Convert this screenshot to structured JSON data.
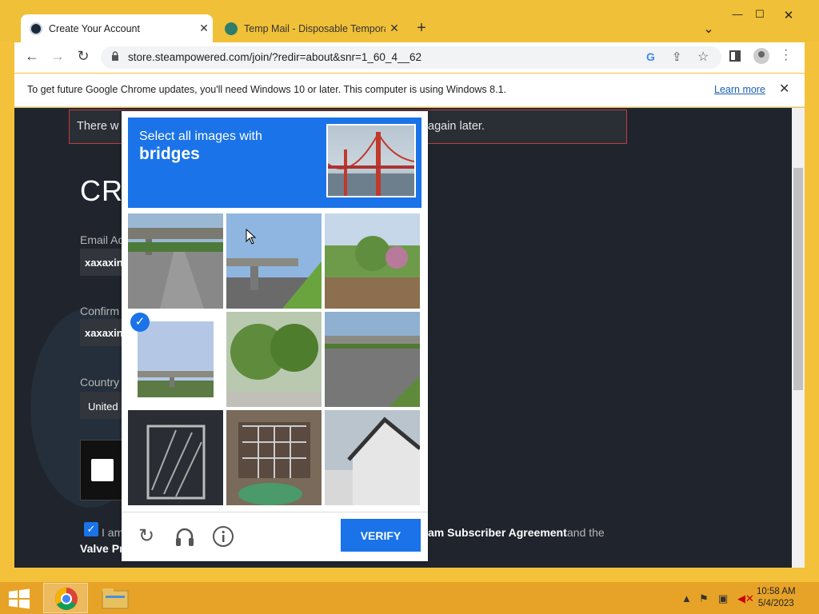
{
  "browser": {
    "tabs": [
      {
        "title": "Create Your Account",
        "active": true
      },
      {
        "title": "Temp Mail - Disposable Tempora",
        "active": false
      }
    ],
    "new_tab_label": "+",
    "window_controls": {
      "dropdown": "⌄",
      "minimize": "—",
      "maximize": "☐",
      "close": "✕"
    },
    "nav": {
      "back": "←",
      "forward": "→",
      "reload": "↻"
    },
    "url": "store.steampowered.com/join/?redir=about&snr=1_60_4__62",
    "toolbar_icons": [
      "google-icon",
      "share-icon",
      "star-icon",
      "sidebar-icon",
      "profile-icon",
      "menu-icon"
    ],
    "infobar": {
      "message": "To get future Google Chrome updates, you'll need Windows 10 or later. This computer is using Windows 8.1.",
      "learn_more": "Learn more",
      "close": "✕"
    }
  },
  "page": {
    "error_left": "There w",
    "error_right": "again later.",
    "title": "CR",
    "email_label": "Email Ac",
    "email_value": "xaxaxin",
    "confirm_label": "Confirm",
    "confirm_value": "xaxaxin",
    "country_label": "Country",
    "country_value": "United",
    "agree_left": "I am",
    "agree_link": "am Subscriber Agreement",
    "agree_and": "and the",
    "agree_line2": "Valve Pr"
  },
  "captcha": {
    "instruction": "Select all images with",
    "target": "bridges",
    "tiles": [
      {
        "label": "highway with overpass",
        "selected": false
      },
      {
        "label": "overpass over road",
        "selected": false
      },
      {
        "label": "trees and field",
        "selected": false
      },
      {
        "label": "overpass sky",
        "selected": true
      },
      {
        "label": "green trees",
        "selected": false
      },
      {
        "label": "highway with bridge",
        "selected": false
      },
      {
        "label": "metal gate",
        "selected": false
      },
      {
        "label": "building with grille",
        "selected": false
      },
      {
        "label": "white house",
        "selected": false
      }
    ],
    "verify_label": "VERIFY",
    "icons": [
      "reload-icon",
      "headphones-icon",
      "info-icon"
    ]
  },
  "taskbar": {
    "time": "10:58 AM",
    "date": "5/4/2023"
  },
  "colors": {
    "accent": "#1a73e8",
    "page_bg": "#1f242d",
    "frame": "#f3c23a"
  }
}
